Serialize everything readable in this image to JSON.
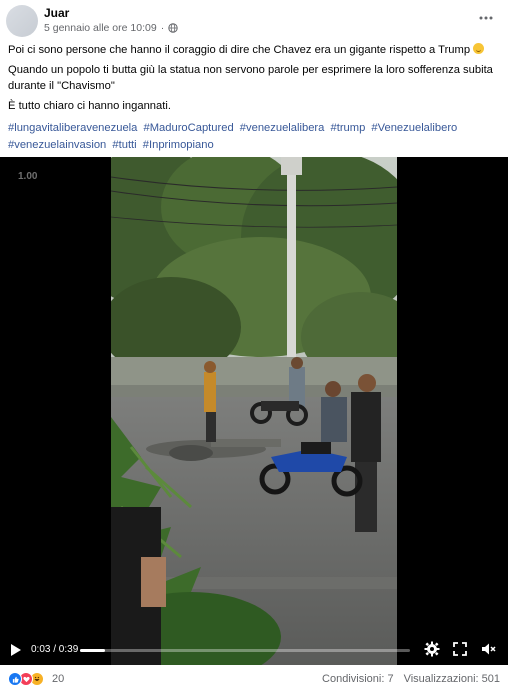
{
  "post": {
    "author": "Juar",
    "date": "5 gennaio alle ore 10:09",
    "privacy_dot": "·",
    "paragraphs": [
      "Poi ci sono persone che hanno il coraggio di dire che Chavez era un gigante rispetto a Trump",
      "Quando un popolo ti butta giù la statua non servono parole per esprimere la loro sofferenza subita durante il \"Chavismo\"",
      "È tutto chiaro ci hanno ingannati."
    ],
    "hashtags": [
      "#lungavitaliberavenezuela",
      "#MaduroCaptured",
      "#venezuelalibera",
      "#trump",
      "#Venezuelalibero",
      "#venezuelainvasion",
      "#tutti",
      "#Inprimopiano"
    ]
  },
  "video": {
    "watermark": "1.00",
    "time_display": "0:03 / 0:39",
    "progress": 0.077
  },
  "footer": {
    "reaction_count": "20",
    "shares": "Condivisioni: 7",
    "views": "Visualizzazioni: 501"
  },
  "colors": {
    "hashtag": "#385898",
    "secondary_text": "#65676b",
    "like": "#1877f2",
    "love": "#f33e58",
    "haha": "#f7b125"
  }
}
